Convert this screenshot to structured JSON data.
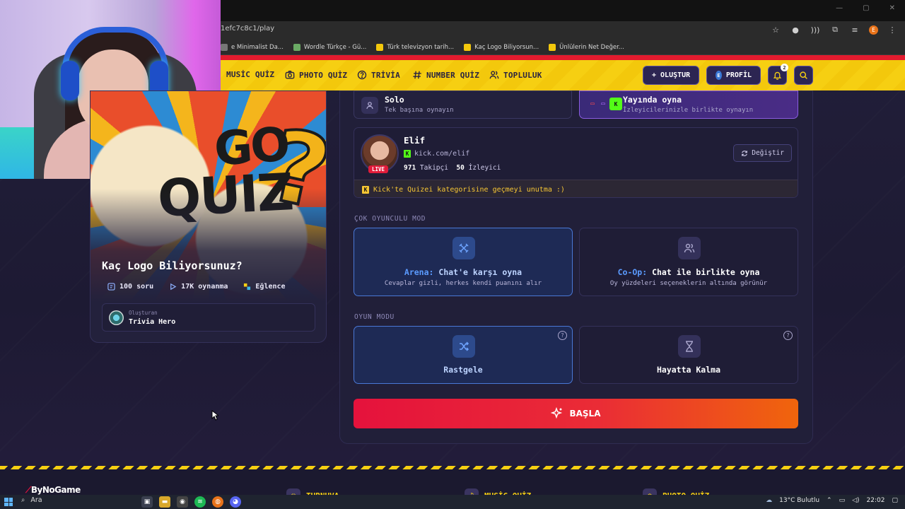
{
  "browser": {
    "url": "1efc7c8c1/play",
    "bookmarks": [
      "e Minimalist Da...",
      "Wordle Türkçe - Gü...",
      "Türk televizyon tarih...",
      "Kaç Logo Biliyorsun...",
      "Ünlülerin Net Değer..."
    ],
    "profile_initial": "E"
  },
  "nav": {
    "items": [
      "MUSİC QUİZ",
      "PHOTO QUİZ",
      "TRİVİA",
      "NUMBER QUİZ",
      "TOPLULUK"
    ],
    "create_label": "OLUŞTUR",
    "profile_label": "PROFİL",
    "profile_initial": "E",
    "notifications_count": "2"
  },
  "quiz": {
    "cover_go": "GO",
    "cover_quiz": "QUIZ",
    "cover_q": "?",
    "title": "Kaç Logo Biliyorsunuz?",
    "questions": "100 soru",
    "plays": "17K oynanma",
    "category": "Eğlence",
    "creator_label": "Oluşturan",
    "creator_name": "Trivia Hero"
  },
  "play_options": {
    "solo": {
      "title": "Solo",
      "subtitle": "Tek başına oynayın"
    },
    "stream": {
      "title": "Yayında oyna",
      "subtitle": "İzleyicilerinizle birlikte oynayın"
    }
  },
  "streamer": {
    "name": "Elif",
    "url": "kick.com/elif",
    "followers": "971",
    "followers_label": "Takipçi",
    "viewers": "50",
    "viewers_label": "İzleyici",
    "live_badge": "LIVE",
    "change_label": "Değiştir",
    "warning": "Kick'te Quizei kategorisine geçmeyi unutma :)"
  },
  "multiplayer": {
    "section_label": "ÇOK OYUNCULU MOD",
    "arena": {
      "prefix": "Arena:",
      "title": "Chat'e karşı oyna",
      "subtitle": "Cevaplar gizli, herkes kendi puanını alır"
    },
    "coop": {
      "prefix": "Co-Op:",
      "title": "Chat ile birlikte oyna",
      "subtitle": "Oy yüzdeleri seçeneklerin altında görünür"
    }
  },
  "game_mode": {
    "section_label": "OYUN MODU",
    "random": "Rastgele",
    "survival": "Hayatta Kalma",
    "help": "?"
  },
  "start_label": "BAŞLA",
  "footer": {
    "brand_prefix": "By",
    "brand_suffix": "NoGame",
    "links": [
      "TURNUVA",
      "MUSİC QUİZ",
      "PHOTO QUİZ"
    ]
  },
  "taskbar": {
    "search": "Ara",
    "weather": "13°C Bulutlu",
    "time": "22:02"
  },
  "colors": {
    "accent_yellow": "#f6cf12",
    "accent_red": "#e5123c",
    "kick_green": "#53fc18",
    "selected_blue": "#4a78d6"
  }
}
